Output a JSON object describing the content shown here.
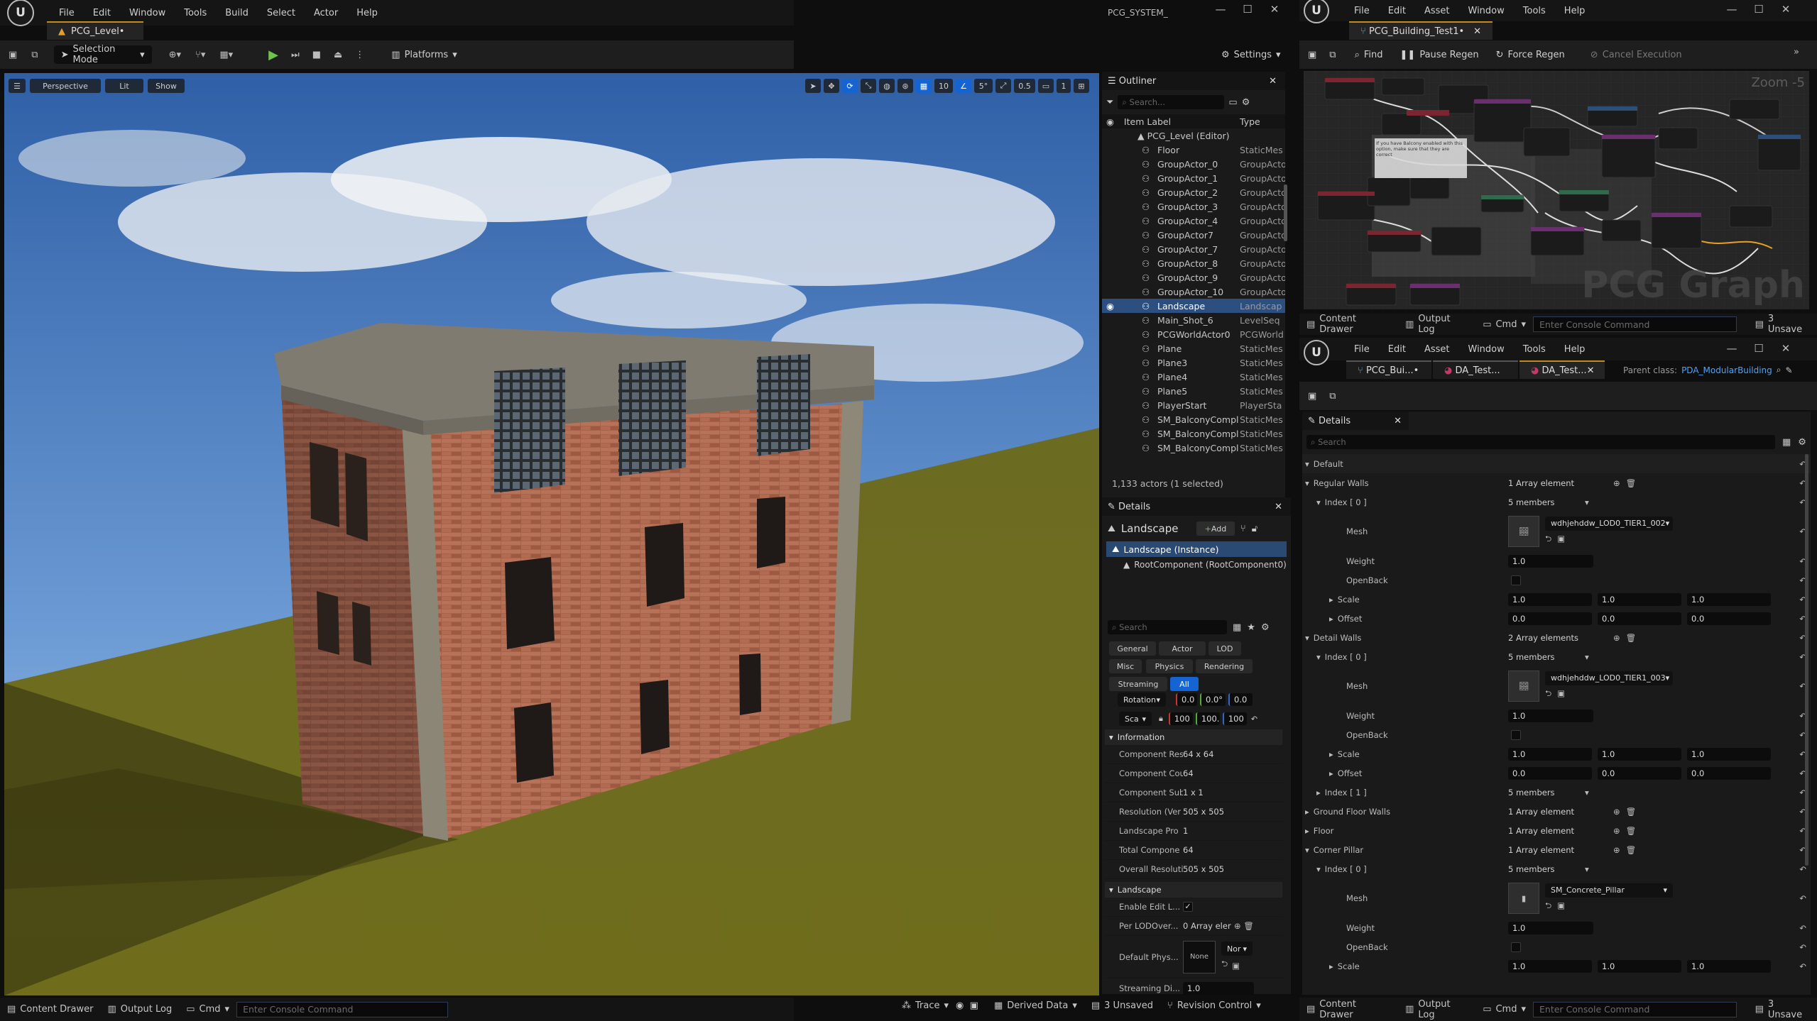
{
  "left_window": {
    "menu": [
      "File",
      "Edit",
      "Window",
      "Tools",
      "Build",
      "Select",
      "Actor",
      "Help"
    ],
    "title": "PCG_SYSTEM_",
    "tab": "PCG_Level•",
    "toolbar": {
      "selection_mode": "Selection Mode",
      "platforms": "Platforms",
      "settings": "Settings"
    },
    "viewport": {
      "perspective": "Perspective",
      "lit": "Lit",
      "show": "Show",
      "grid": "10",
      "angle": "5°",
      "scale": "0.5",
      "camera": "1"
    }
  },
  "outliner": {
    "title": "Outliner",
    "search_placeholder": "Search...",
    "col_label": "Item Label",
    "col_type": "Type",
    "root": "PCG_Level (Editor)",
    "items": [
      {
        "label": "Floor",
        "type": "StaticMes"
      },
      {
        "label": "GroupActor_0",
        "type": "GroupActo"
      },
      {
        "label": "GroupActor_1",
        "type": "GroupActo"
      },
      {
        "label": "GroupActor_2",
        "type": "GroupActo"
      },
      {
        "label": "GroupActor_3",
        "type": "GroupActo"
      },
      {
        "label": "GroupActor_4",
        "type": "GroupActo"
      },
      {
        "label": "GroupActor7",
        "type": "GroupActo"
      },
      {
        "label": "GroupActor_7",
        "type": "GroupActo"
      },
      {
        "label": "GroupActor_8",
        "type": "GroupActo"
      },
      {
        "label": "GroupActor_9",
        "type": "GroupActo"
      },
      {
        "label": "GroupActor_10",
        "type": "GroupActo"
      },
      {
        "label": "Landscape",
        "type": "Landscap"
      },
      {
        "label": "Main_Shot_6",
        "type": "LevelSeq"
      },
      {
        "label": "PCGWorldActor0",
        "type": "PCGWorld"
      },
      {
        "label": "Plane",
        "type": "StaticMes"
      },
      {
        "label": "Plane3",
        "type": "StaticMes"
      },
      {
        "label": "Plane4",
        "type": "StaticMes"
      },
      {
        "label": "Plane5",
        "type": "StaticMes"
      },
      {
        "label": "PlayerStart",
        "type": "PlayerSta"
      },
      {
        "label": "SM_BalconyCompl",
        "type": "StaticMes"
      },
      {
        "label": "SM_BalconyCompl",
        "type": "StaticMes"
      },
      {
        "label": "SM_BalconyCompl",
        "type": "StaticMes"
      }
    ],
    "footer": "1,133 actors (1 selected)"
  },
  "details_left": {
    "title": "Details",
    "actor": "Landscape",
    "add": "Add",
    "instance": "Landscape (Instance)",
    "root_component": "RootComponent (RootComponent0)",
    "search_placeholder": "Search",
    "filters": [
      "General",
      "Actor",
      "LOD",
      "Misc",
      "Physics",
      "Rendering",
      "Streaming",
      "All"
    ],
    "rotation_label": "Rotation",
    "rotation": [
      "0.0",
      "0.0°",
      "0.0"
    ],
    "scale_label": "Sca",
    "scale": [
      "100",
      "100.",
      "100"
    ],
    "info_section": "Information",
    "info": [
      {
        "k": "Component Res",
        "v": "64 x 64"
      },
      {
        "k": "Component Cou",
        "v": "64"
      },
      {
        "k": "Component Sub",
        "v": "1 x 1"
      },
      {
        "k": "Resolution (Ver",
        "v": "505 x 505"
      },
      {
        "k": "Landscape Pro",
        "v": "1"
      },
      {
        "k": "Total Compone",
        "v": "64"
      },
      {
        "k": "Overall Resoluti",
        "v": "505 x 505"
      }
    ],
    "landscape_section": "Landscape",
    "enable_edit": "Enable Edit L...",
    "per_lod": "Per LODOver...",
    "per_lod_value": "0 Array eler",
    "default_phys": "Default Phys...",
    "default_phys_none": "None",
    "default_phys_sel": "Nor",
    "streaming": "Streaming Di...",
    "streaming_value": "1.0"
  },
  "status_left": {
    "content_drawer": "Content Drawer",
    "output_log": "Output Log",
    "cmd": "Cmd",
    "console_placeholder": "Enter Console Command",
    "trace": "Trace",
    "derived_data": "Derived Data",
    "unsaved": "3 Unsaved",
    "revision": "Revision Control"
  },
  "pcg_window": {
    "menu": [
      "File",
      "Edit",
      "Asset",
      "Window",
      "Tools",
      "Help"
    ],
    "tab": "PCG_Building_Test1•",
    "toolbar": {
      "find": "Find",
      "pause": "Pause Regen",
      "force": "Force Regen",
      "cancel": "Cancel Execution"
    },
    "zoom": "Zoom -5",
    "watermark": "PCG Graph",
    "comment": "If you have Balcony enabled with this option, make sure that they are correct",
    "status": {
      "content_drawer": "Content Drawer",
      "output_log": "Output Log",
      "cmd": "Cmd",
      "console_placeholder": "Enter Console Command",
      "unsaved": "3 Unsave"
    }
  },
  "da_window": {
    "menu": [
      "File",
      "Edit",
      "Asset",
      "Window",
      "Tools",
      "Help"
    ],
    "tabs": [
      "PCG_Bui...•",
      "DA_Test...",
      "DA_Test..."
    ],
    "parent_label": "Parent class:",
    "parent_value": "PDA_ModularBuilding",
    "details_title": "Details",
    "search_placeholder": "Search",
    "section": "Default",
    "regular_walls": "Regular Walls",
    "regular_walls_val": "1 Array element",
    "index0": "Index [ 0 ]",
    "members5": "5 members",
    "mesh": "Mesh",
    "mesh1": "wdhjehddw_LOD0_TIER1_002",
    "weight": "Weight",
    "weight_val": "1.0",
    "openback": "OpenBack",
    "scale": "Scale",
    "scale_vals": [
      "1.0",
      "1.0",
      "1.0"
    ],
    "offset": "Offset",
    "offset_vals": [
      "0.0",
      "0.0",
      "0.0"
    ],
    "detail_walls": "Detail Walls",
    "detail_walls_val": "2 Array elements",
    "mesh2": "wdhjehddw_LOD0_TIER1_003",
    "index1": "Index [ 1 ]",
    "ground_floor": "Ground Floor Walls",
    "floor": "Floor",
    "corner_pillar": "Corner Pillar",
    "one_array": "1 Array element",
    "mesh3": "SM_Concrete_Pillar",
    "status": {
      "content_drawer": "Content Drawer",
      "output_log": "Output Log",
      "cmd": "Cmd",
      "console_placeholder": "Enter Console Command",
      "unsaved": "3 Unsave"
    }
  }
}
